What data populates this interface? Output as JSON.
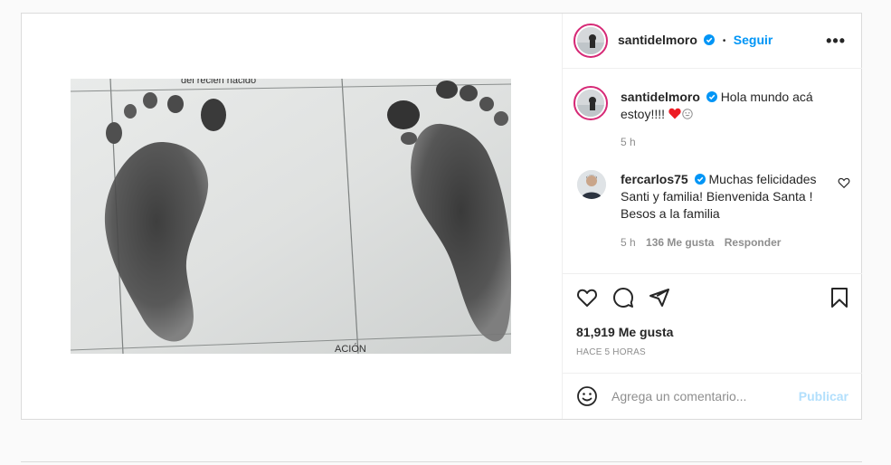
{
  "post": {
    "author": {
      "username": "santidelmoro",
      "verified": true,
      "follow_label": "Seguir",
      "more_icon": "more-horizontal-icon"
    },
    "caption": {
      "username": "santidelmoro",
      "text": "Hola mundo acá estoy!!!! ",
      "emoji": [
        "red-heart",
        "grinning-face"
      ],
      "time": "5 h"
    },
    "comments": [
      {
        "username": "fercarlos75",
        "verified": true,
        "text": "Muchas felicidades Santi y familia! Bienvenida Santa ! Besos a la familia",
        "time": "5 h",
        "likes": "136 Me gusta",
        "reply_label": "Responder"
      }
    ],
    "actions": {
      "like": "heart-icon",
      "comment": "comment-icon",
      "share": "send-icon",
      "save": "bookmark-icon"
    },
    "likes_count": "81,919 Me gusta",
    "posted_ago": "HACE 5 HORAS",
    "add_comment": {
      "placeholder": "Agrega un comentario...",
      "emoji_icon": "smiley-icon",
      "publish_label": "Publicar"
    },
    "photo_text": {
      "top": "del recién nacido",
      "bottom": "ACIÓN"
    }
  },
  "colors": {
    "link_blue": "#0095f6",
    "publish_disabled": "#b2dffc",
    "heart_red": "#ed1c24",
    "story_ring": "#d62976"
  }
}
